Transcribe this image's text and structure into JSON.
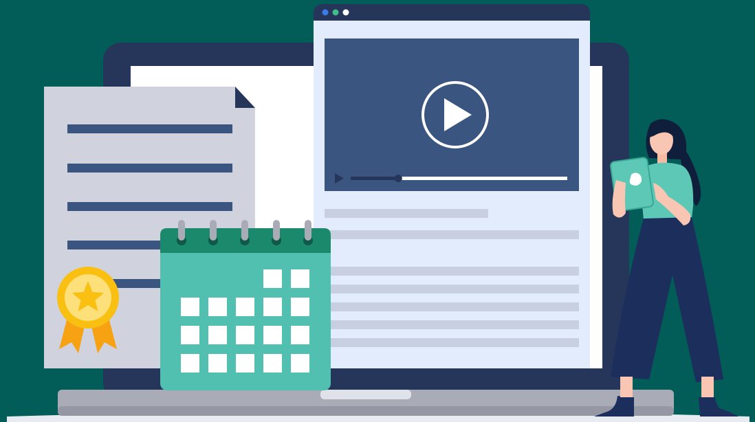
{
  "colors": {
    "background": "#025c58",
    "laptop_frame": "#26365a",
    "laptop_screen": "#ffffff",
    "laptop_base": "#a9abb7",
    "document": "#d0d2de",
    "document_line": "#3a5580",
    "browser_window": "#e3ecfc",
    "browser_titlebar": "#26365a",
    "video_panel": "#3a5580",
    "placeholder_line": "#c8cfe0",
    "calendar_body": "#52c0b1",
    "calendar_header": "#1b8a6c",
    "badge_gold": "#f9c012",
    "person_shirt": "#5cc8b5",
    "person_pants": "#1c2e5c"
  },
  "browser": {
    "window_dots": [
      "#3a7bea",
      "#3fbf8a",
      "#ffffff"
    ]
  },
  "video_player": {
    "state": "paused",
    "progress": 0.22
  },
  "icons": {
    "play": "play-icon",
    "small_play": "small-play-icon",
    "award": "award-ribbon-icon",
    "star": "star-icon",
    "calendar": "calendar-icon"
  }
}
